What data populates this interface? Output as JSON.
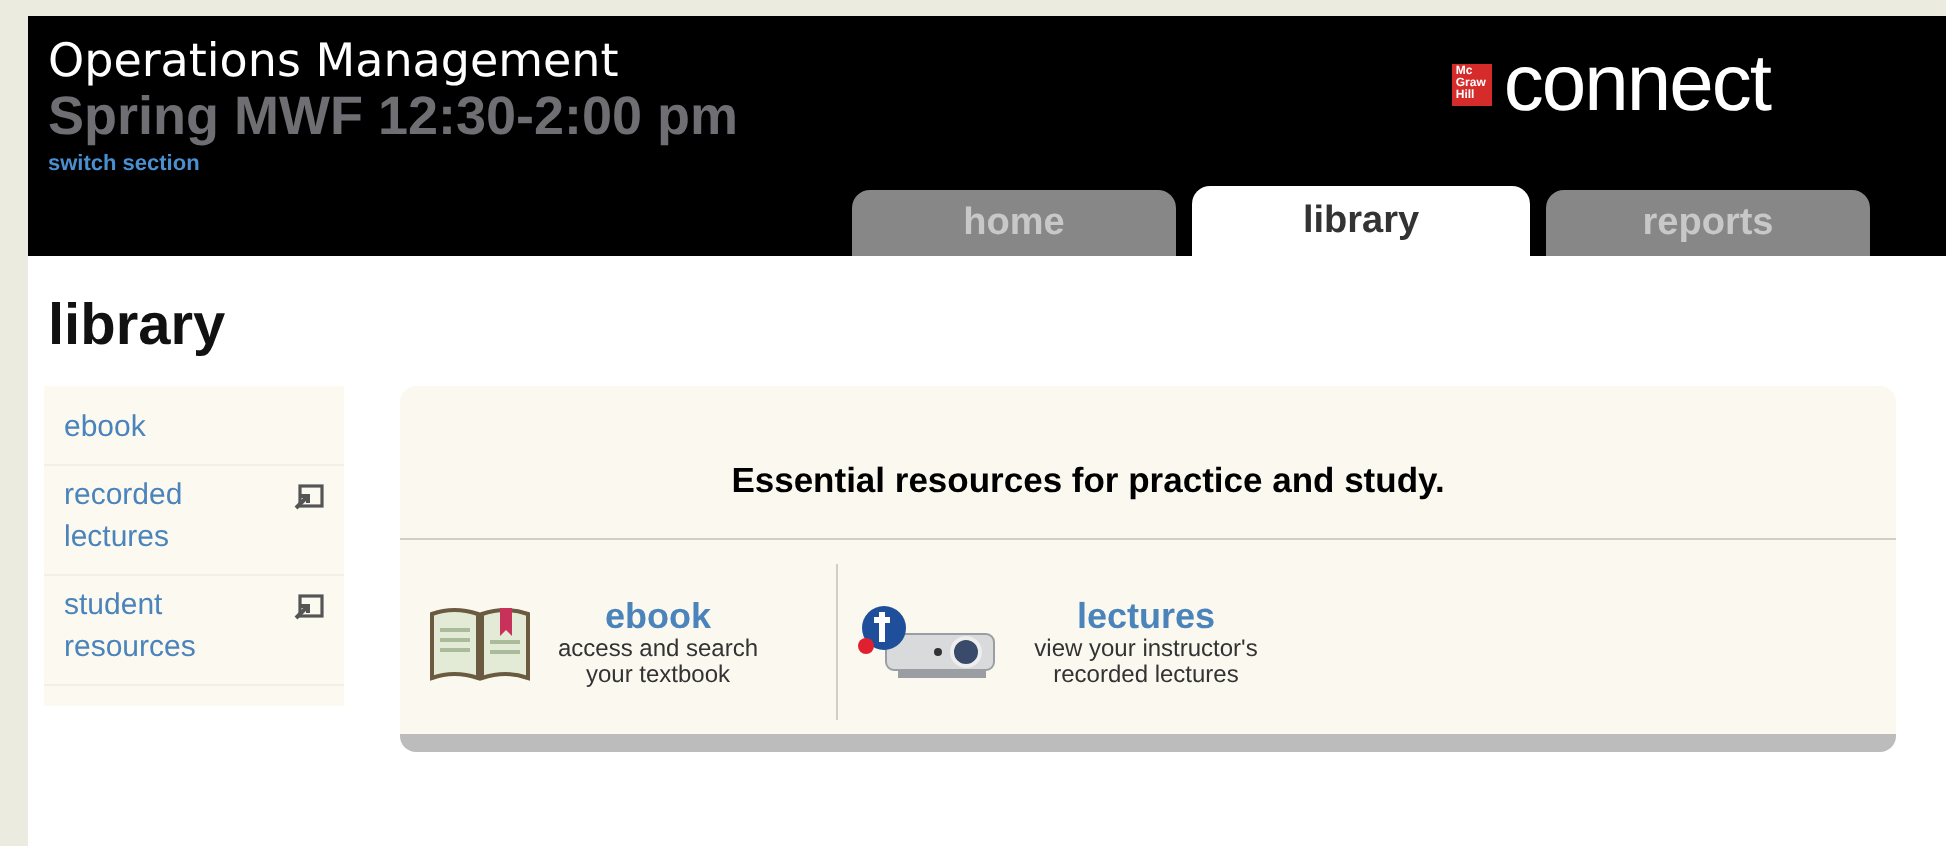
{
  "header": {
    "course_title": "Operations Management",
    "section": "Spring MWF 12:30-2:00 pm",
    "switch_link": "switch section",
    "logo": {
      "badge_lines": [
        "Mc",
        "Graw",
        "Hill"
      ],
      "wordmark": "connect"
    }
  },
  "tabs": [
    {
      "label": "home",
      "selected": false
    },
    {
      "label": "library",
      "selected": true
    },
    {
      "label": "reports",
      "selected": false
    }
  ],
  "page_title": "library",
  "sidebar": {
    "items": [
      {
        "label": "ebook",
        "external": false
      },
      {
        "label": "recorded lectures",
        "external": true
      },
      {
        "label": "student resources",
        "external": true
      }
    ]
  },
  "resources": {
    "headline": "Essential resources for practice and study.",
    "items": [
      {
        "kind": "book",
        "title": "ebook",
        "description": "access and search your textbook"
      },
      {
        "kind": "projector",
        "title": "lectures",
        "description": "view your instructor's recorded lectures"
      }
    ]
  }
}
